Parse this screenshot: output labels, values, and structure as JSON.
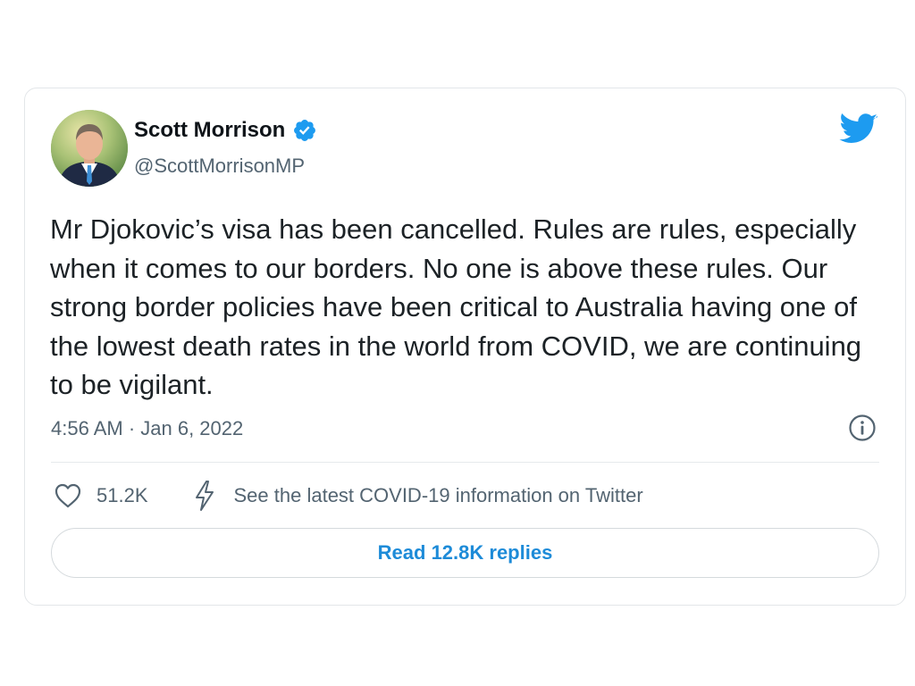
{
  "author": {
    "display_name": "Scott Morrison",
    "handle": "@ScottMorrisonMP",
    "verified": true
  },
  "tweet": {
    "text": "Mr Djokovic’s visa has been cancelled. Rules are rules, especially when it comes to our borders. No one is above these rules. Our strong border policies have been critical to Australia having one of the lowest death rates in the world from COVID, we are continuing to be vigilant.",
    "timestamp": "4:56 AM · Jan 6, 2022"
  },
  "actions": {
    "like_count": "51.2K",
    "covid_info": "See the latest COVID-19 information on Twitter"
  },
  "replies_button": {
    "label": "Read 12.8K replies"
  },
  "colors": {
    "brand_blue": "#1d9bf0",
    "link_blue": "#1d8bd8",
    "secondary_text": "#536471"
  },
  "icons": [
    "verified-badge-icon",
    "twitter-bird-icon",
    "info-icon",
    "heart-icon",
    "lightning-bolt-icon"
  ]
}
